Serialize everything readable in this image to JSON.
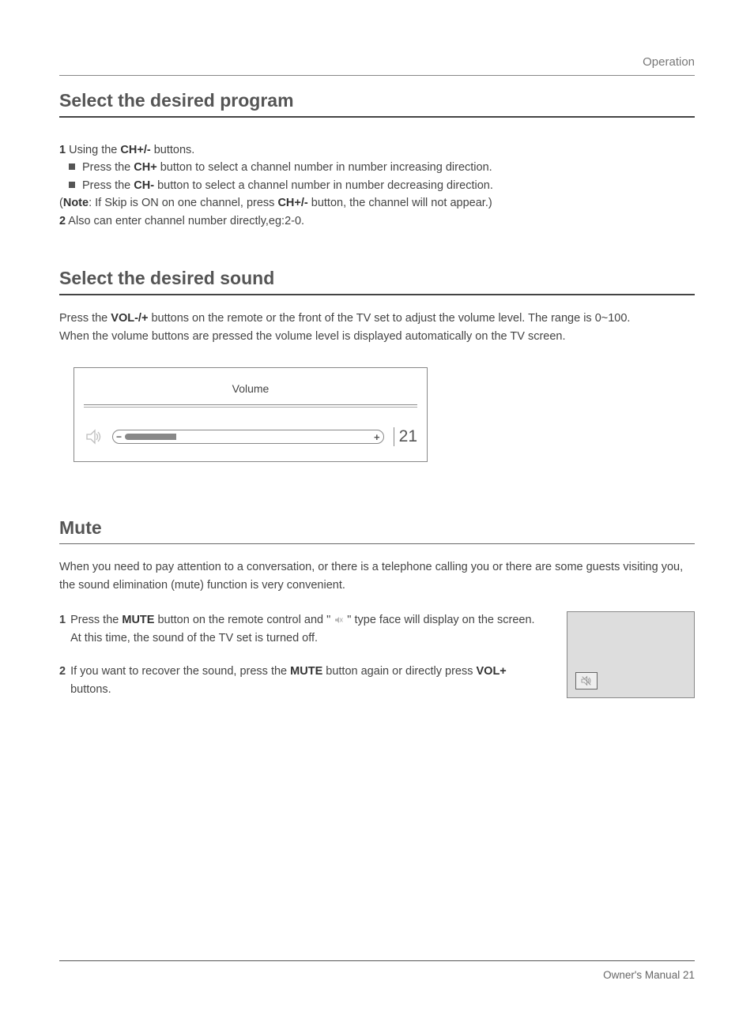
{
  "header": {
    "label": "Operation"
  },
  "section1": {
    "title": "Select the desired program",
    "line1_a": "1",
    "line1_b": " Using the ",
    "line1_c": "CH+/-",
    "line1_d": " buttons.",
    "bullet1_a": "Press the ",
    "bullet1_b": "CH+",
    "bullet1_c": " button to select a channel number in number increasing direction.",
    "bullet2_a": "Press the ",
    "bullet2_b": "CH-",
    "bullet2_c": " button to select a channel number in number decreasing direction.",
    "note_a": "(",
    "note_b": "Note",
    "note_c": ": If Skip is ON on one channel, press ",
    "note_d": "CH+/-",
    "note_e": " button, the channel will not appear.)",
    "line2_a": "2",
    "line2_b": " Also can enter channel number directly,eg:2-0."
  },
  "section2": {
    "title": "Select the desired sound",
    "p1_a": "Press the ",
    "p1_b": "VOL-/+",
    "p1_c": "  buttons on the remote or the front of the TV set to adjust the volume level. The range is 0~100.",
    "p2": "When the volume buttons are pressed the volume level is displayed automatically on the TV screen.",
    "volume_label": "Volume",
    "volume_value": "21"
  },
  "section3": {
    "title": "Mute",
    "intro_a": "When you need to pay attention to ",
    "intro_b": "a conversation",
    "intro_c": ", or there is a telephone calling you or  there are some guests visiting you, the sound elimination (mute) function is very convenient.",
    "step1_num": "1",
    "step1_a": "Press the ",
    "step1_b": "MUTE",
    "step1_c": " button on the remote control and  \" ",
    "step1_d": " \" type face will display on the screen. At this time, the sound of the TV set is turned off.",
    "step2_num": "2",
    "step2_a": "If you want to recover the sound, press the ",
    "step2_b": "MUTE",
    "step2_c": " button again or directly press ",
    "step2_d": "VOL+",
    "step2_e": " buttons."
  },
  "footer": {
    "label": "Owner's Manual",
    "page": "21"
  }
}
